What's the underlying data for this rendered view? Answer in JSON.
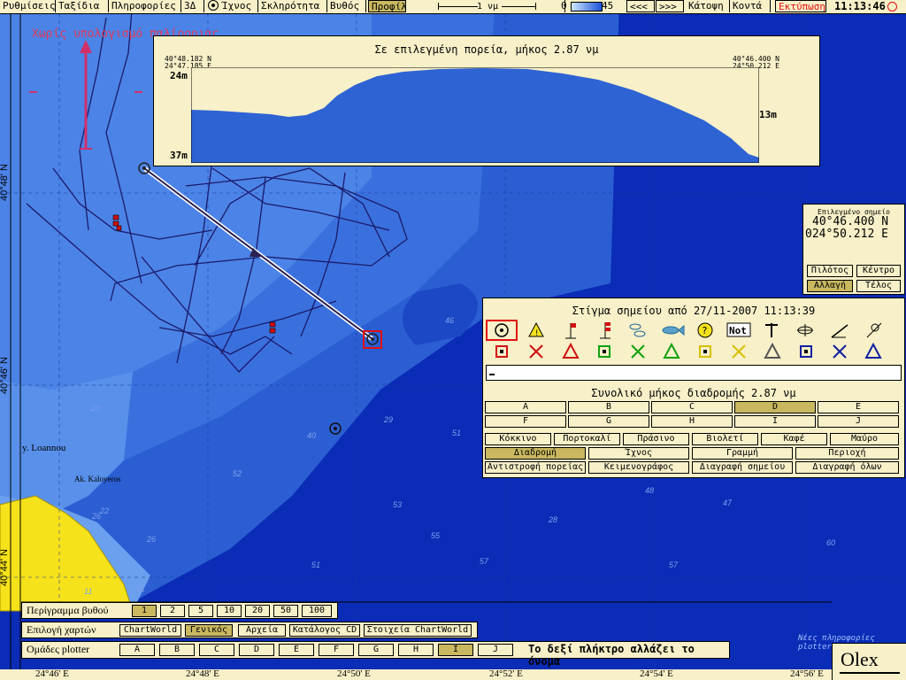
{
  "topbar": {
    "menu": [
      "Ρυθμίσεις",
      "Ταξίδια",
      "Πληροφορίες",
      "3Δ",
      "Ίχνος",
      "Σκληρότητα",
      "Βυθός",
      "Προφίλ"
    ],
    "scale_label": "1 νμ",
    "depth_scale_min": "0",
    "depth_scale_max": "45",
    "nav_prev": "<<<",
    "nav_next": ">>>",
    "view_top": "Κάτοψη",
    "view_close": "Κοντά",
    "print": "Εκτύπωση",
    "clock": "11:13:46"
  },
  "overlay_warning": "Χωρίς υπολογισμό παλίρροιας",
  "profile": {
    "title": "Σε επιλεγμένη πορεία, μήκος 2.87 νμ",
    "left_coord_1": "40°48.182 N",
    "left_coord_2": "24°47.185 E",
    "right_coord_1": "40°46.400 N",
    "right_coord_2": "24°50.212 E",
    "depth_top": "24m",
    "depth_bottom": "37m",
    "depth_right": "13m"
  },
  "selected_point": {
    "label": "Επιλεγμένο σημείο",
    "lat": "40°46.400 N",
    "lon": "024°50.212 E",
    "buttons": [
      "Πιλότος",
      "Κέντρο",
      "Αλλαγή",
      "Τέλος"
    ]
  },
  "mark_panel": {
    "title": "Στίγμα σημείου από 27/11-2007 11:13:39",
    "icon_row1": [
      "target-icon",
      "warning-icon",
      "flag-icon",
      "double-flag-icon",
      "fish-school-icon",
      "fish-icon",
      "question-icon",
      "not-icon",
      "anchor-hook-icon",
      "wreck-icon",
      "fishing-rod-icon",
      "net-icon"
    ],
    "icon_row2": [
      "red-square-icon",
      "red-x-icon",
      "red-triangle-icon",
      "green-square-icon",
      "green-x-icon",
      "green-triangle-icon",
      "yellow-square-icon",
      "yellow-x-icon",
      "yellow-triangle-icon",
      "blue-square-icon",
      "blue-x-icon",
      "blue-triangle-icon"
    ],
    "not_text": "Not",
    "route_total": "Συνολικό μήκος διαδρομής 2.87 νμ",
    "letters": [
      "A",
      "B",
      "C",
      "D",
      "E",
      "F",
      "G",
      "H",
      "I",
      "J"
    ],
    "colors": [
      "Κόκκινο",
      "Πορτοκαλί",
      "Πράσινο",
      "Βιολετί",
      "Καφέ",
      "Μαύρο"
    ],
    "types": [
      "Διαδρομή",
      "Ίχνος",
      "Γραμμή",
      "Περιοχή"
    ],
    "actions": [
      "Αντιστροφή πορείας",
      "Κειμενογράφος",
      "Διαγραφή σημείου",
      "Διαγραφή όλων"
    ]
  },
  "depth_outline": {
    "label": "Περίγραμμα βυθού",
    "options": [
      "1",
      "2",
      "5",
      "10",
      "20",
      "50",
      "100"
    ]
  },
  "chart_select": {
    "label": "Επιλογή χαρτών",
    "options": [
      "ChartWorld",
      "Γενικός",
      "Αρχεία",
      "Κατάλογος CD",
      "Στοιχεία ChartWorld"
    ]
  },
  "plotter_groups": {
    "label": "Ομάδες plotter",
    "options": [
      "A",
      "B",
      "C",
      "D",
      "E",
      "F",
      "G",
      "H",
      "I",
      "J"
    ],
    "hint": "Το δεξί πλήκτρο αλλάζει το όνομα"
  },
  "new_plotter_info": "Νέες πληροφορίες plotter",
  "brand": "Olex",
  "map": {
    "place_1": "y. Loannou",
    "place_2": "Ak. Kaloyeros",
    "lat_labels": [
      "40°48' N",
      "40°46' N",
      "40°44' N"
    ],
    "lon_labels": [
      "24°46' E",
      "24°48' E",
      "24°50' E",
      "24°52' E",
      "24°54' E",
      "24°56' E"
    ],
    "soundings": [
      "46",
      "20",
      "26",
      "51",
      "40",
      "22",
      "53",
      "26",
      "53",
      "52",
      "55",
      "51",
      "57",
      "57",
      "60",
      "11",
      "21",
      "29",
      "28",
      "48",
      "47"
    ]
  }
}
